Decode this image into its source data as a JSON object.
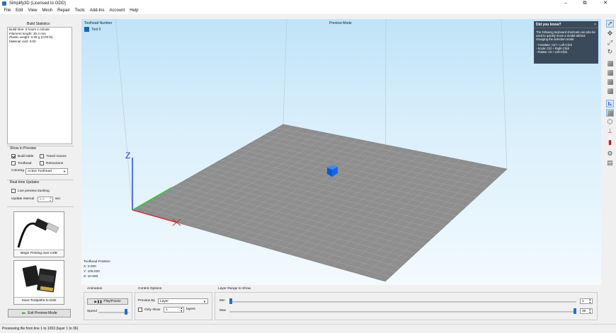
{
  "window": {
    "title": "Simplify3D (Licensed to GDD)",
    "minimize": "–",
    "maximize": "⧉",
    "close": "✕"
  },
  "menu": [
    "File",
    "Edit",
    "View",
    "Mesh",
    "Repair",
    "Tools",
    "Add-Ins",
    "Account",
    "Help"
  ],
  "left": {
    "build_stats_title": "Build Statistics",
    "build_stats": [
      "Build time: 0 hours 1 minute",
      "Filament length: 30.4 mm",
      "Plastic weight: 0.09 g (0.00 lb)",
      "Material cost: 0.00"
    ],
    "show_in_preview": {
      "title": "Show in Preview",
      "build_table": "Build table",
      "travel_moves": "Travel moves",
      "toolhead": "Toolhead",
      "retractions": "Retractions",
      "coloring_label": "Coloring",
      "coloring_value": "Active Toolhead"
    },
    "realtime": {
      "title": "Real-time Updates",
      "live_preview": "Live preview tracking",
      "interval_label": "Update interval",
      "interval_value": "5.0",
      "interval_unit": "sec"
    },
    "usb_button": "Begin Printing over USB",
    "sd_button": "Save Toolpaths to Disk",
    "exit_button": "Exit Preview Mode"
  },
  "viewport": {
    "toolhead_number_label": "Toolhead Number",
    "tool0": "Tool 0",
    "mode": "Preview Mode",
    "axis_z": "Z",
    "toolhead_position_label": "Toolhead Position",
    "x": "X: 0.000",
    "y": "Y: 105.000",
    "z": "Z: 10.590"
  },
  "tip": {
    "title": "Did you know?",
    "close": "×",
    "body": "The following keyboard shortcuts can also be used to quickly move a model without changing the selection mode:",
    "line1": "- Translate: Ctrl + Left-Click",
    "line2": "- Scale: Ctrl + Right-Click",
    "line3": "- Rotate: Alt + Left-Click"
  },
  "animation": {
    "title": "Animation",
    "play_pause": "Play/Pause",
    "speed_label": "Speed",
    "speed_value": 0.95
  },
  "control": {
    "title": "Control Options",
    "preview_by_label": "Preview By",
    "preview_by_value": "Layer",
    "only_show": "Only show",
    "only_show_value": "1",
    "layers": "layers"
  },
  "layer_range": {
    "title": "Layer Range to Show",
    "min_label": "Min",
    "min_value": "1",
    "max_label": "Max",
    "max_value": "36",
    "min_fraction": 0.0,
    "max_fraction": 1.0
  },
  "status": "Previewing file from line 1 to 1653 (layer 1 to 36)",
  "colors": {
    "accent": "#1e6fd9",
    "bed": "#8c8c8c",
    "tip_bg": "#3b4a5a"
  }
}
